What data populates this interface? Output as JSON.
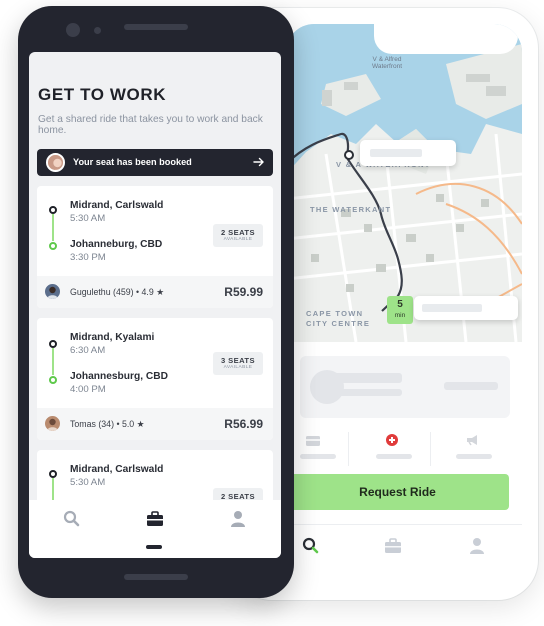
{
  "back_screen": {
    "map": {
      "area_labels": [
        "V & A WATERFRONT",
        "THE WATERKANT",
        "CAPE TOWN CITY CENTRE"
      ],
      "place_label": "V & Alfred Waterfront",
      "eta": {
        "value": "5",
        "unit": "min"
      }
    },
    "actions": {
      "icons": [
        "card-icon",
        "medical-cross-icon",
        "megaphone-icon"
      ]
    },
    "request_button": "Request Ride",
    "nav": {
      "icons": [
        "search-icon",
        "briefcase-icon",
        "profile-icon"
      ]
    }
  },
  "front_screen": {
    "title": "GET TO WORK",
    "subtitle": "Get a shared ride that takes you to work and back home.",
    "booking_banner": "Your seat has been booked",
    "rides": [
      {
        "from": "Midrand, Carlswald",
        "from_time": "5:30 AM",
        "to": "Johanneburg, CBD",
        "to_time": "3:30 PM",
        "seats": "2 SEATS",
        "seats_sub": "AVAILABLE",
        "driver": "Gugulethu (459) • 4.9 ★",
        "price": "R59.99"
      },
      {
        "from": "Midrand, Kyalami",
        "from_time": "6:30 AM",
        "to": "Johannesburg, CBD",
        "to_time": "4:00 PM",
        "seats": "3 SEATS",
        "seats_sub": "AVAILABLE",
        "driver": "Tomas (34) • 5.0 ★",
        "price": "R56.99"
      },
      {
        "from": "Midrand, Carlswald",
        "from_time": "5:30 AM",
        "seats": "2 SEATS"
      }
    ],
    "nav": {
      "icons": [
        "search-icon",
        "briefcase-icon",
        "profile-icon"
      ]
    }
  },
  "colors": {
    "accent": "#9ee389",
    "dark": "#23252f",
    "route_green": "#5fc94c"
  }
}
